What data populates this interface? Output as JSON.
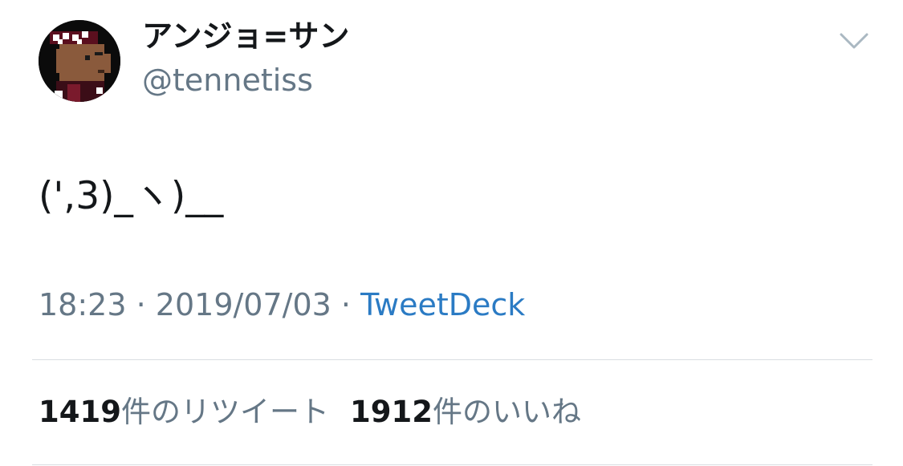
{
  "user": {
    "display_name": "アンジョ=サン",
    "handle": "@tennetiss"
  },
  "tweet": {
    "text": "(',3)_ヽ)__",
    "time": "18:23",
    "date": "2019/07/03",
    "separator": "·",
    "source": "TweetDeck"
  },
  "stats": {
    "retweets": {
      "count": "1419",
      "label": "件のリツイート"
    },
    "likes": {
      "count": "1912",
      "label": "件のいいね"
    }
  },
  "icons": {
    "avatar": "pixel-art-avatar",
    "menu": "chevron-down-icon"
  },
  "colors": {
    "text_primary": "#14171a",
    "text_secondary": "#657786",
    "link": "#2b7bc4",
    "divider": "#d9dde1"
  }
}
